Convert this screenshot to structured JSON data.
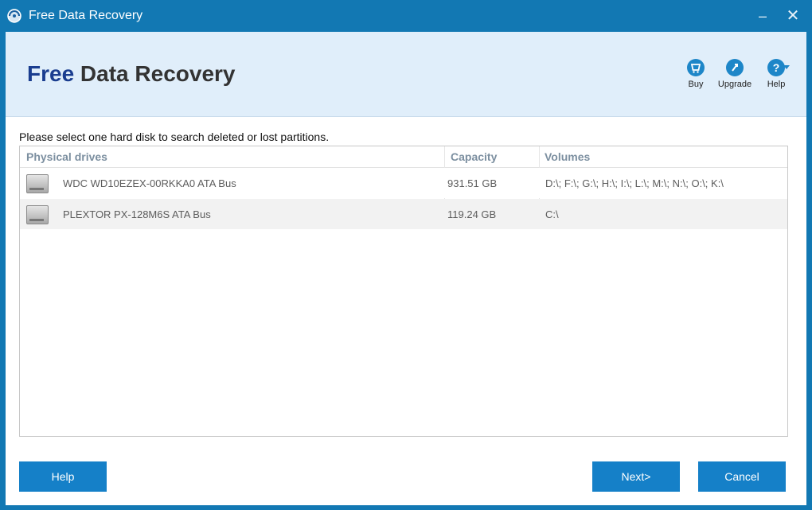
{
  "window": {
    "title": "Free Data Recovery",
    "minimize_glyph": "–",
    "close_glyph": "✕"
  },
  "header": {
    "brand_first": "Free",
    "brand_rest": " Data Recovery",
    "buttons": [
      {
        "label": "Buy",
        "icon": "cart-icon"
      },
      {
        "label": "Upgrade",
        "icon": "upgrade-icon"
      },
      {
        "label": "Help",
        "icon": "question-icon"
      }
    ]
  },
  "instruction": "Please select one hard disk to search deleted or lost partitions.",
  "table": {
    "columns": [
      "Physical drives",
      "Capacity",
      "Volumes"
    ],
    "rows": [
      {
        "drive": "WDC WD10EZEX-00RKKA0  ATA Bus",
        "capacity": "931.51 GB",
        "volumes": "D:\\; F:\\; G:\\; H:\\; I:\\; L:\\; M:\\; N:\\; O:\\; K:\\"
      },
      {
        "drive": "PLEXTOR PX-128M6S  ATA Bus",
        "capacity": "119.24 GB",
        "volumes": "C:\\"
      }
    ]
  },
  "footer": {
    "help_label": "Help",
    "next_label": "Next>",
    "cancel_label": "Cancel"
  },
  "colors": {
    "titlebar": "#1278b3",
    "header_bg": "#e0eefa",
    "button_bg": "#1580c8",
    "brand_accent": "#1a3d8f"
  }
}
